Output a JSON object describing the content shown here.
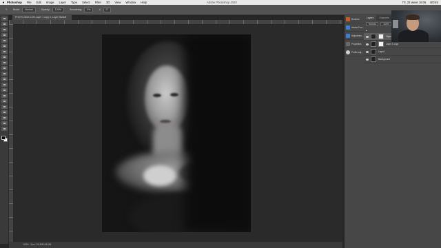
{
  "menubar": {
    "app": "Photoshop",
    "items": [
      "File",
      "Edit",
      "Image",
      "Layer",
      "Type",
      "Select",
      "Filter",
      "3D",
      "View",
      "Window",
      "Help"
    ],
    "window_title": "Adobe Photoshop 2020",
    "clock": "Пт, 22 июня 16:06",
    "user": "BOSS"
  },
  "options_bar": {
    "mode_label": "Mode:",
    "mode_value": "Normal",
    "opacity_label": "Opacity:",
    "opacity_value": "100%",
    "smoothing_label": "Smoothing:",
    "smoothing_value": "0%",
    "angle_value": "0°"
  },
  "document_tab": "PHOTO-Wolf-4.CR-Layer 1 copy 2, Layer Mask/8",
  "status_bar": "100% · Doc: 24.3M/148.2M",
  "panels_collapsed": [
    {
      "label": "Brushes",
      "icon_color": "#c85a2a"
    },
    {
      "label": "Adobe Fon...",
      "icon_color": "#3a7fd0"
    },
    {
      "label": "Adjustmen...",
      "icon_color": "#3a7fd0"
    },
    {
      "label": "Properties",
      "icon_color": "#6a6a6a"
    },
    {
      "label": "Profile adj...",
      "icon_color": "#cfcfcf"
    }
  ],
  "layers_panel": {
    "tabs": [
      "Layers",
      "Channels",
      "Paths"
    ],
    "active_tab": "Layers",
    "blend_mode": "Normal",
    "opacity": "100%",
    "layers": [
      {
        "name": "Layer 1 copy 2",
        "selected": true,
        "mask": true
      },
      {
        "name": "Layer 1 copy",
        "selected": false,
        "mask": true
      },
      {
        "name": "Layer 1",
        "selected": false,
        "mask": false
      },
      {
        "name": "Background",
        "selected": false,
        "mask": false
      }
    ]
  },
  "colors": {
    "workspace": "#262626",
    "panel": "#474747",
    "foreground_swatch": "#0a0a0a",
    "background_swatch": "#fafafa"
  }
}
